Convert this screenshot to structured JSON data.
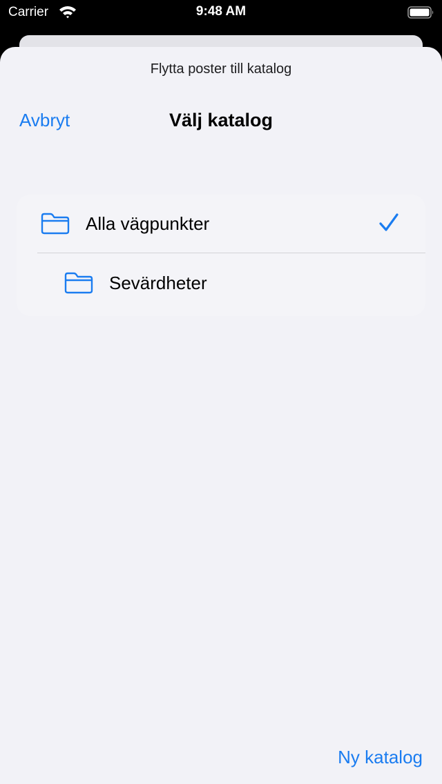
{
  "status_bar": {
    "carrier": "Carrier",
    "time": "9:48 AM",
    "wifi_icon": "wifi-icon",
    "battery_icon": "battery-icon"
  },
  "sheet": {
    "caption": "Flytta poster till katalog"
  },
  "nav": {
    "cancel_label": "Avbryt",
    "title": "Välj katalog"
  },
  "folders": [
    {
      "label": "Alla vägpunkter",
      "icon": "folder-icon",
      "selected": true,
      "level": 0
    },
    {
      "label": "Sevärdheter",
      "icon": "folder-icon",
      "selected": false,
      "level": 1
    }
  ],
  "toolbar": {
    "new_folder_label": "Ny katalog"
  },
  "colors": {
    "accent": "#1a7cf0",
    "background": "#f2f2f7",
    "status_bar": "#000000"
  }
}
